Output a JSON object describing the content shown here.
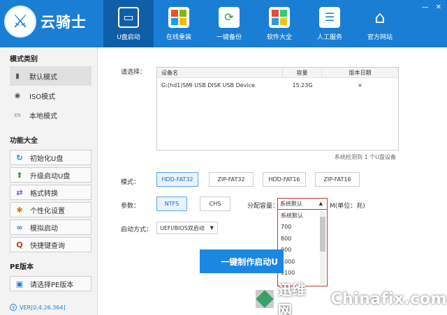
{
  "app": {
    "title": "云骑士",
    "logo_glyph": "⚔",
    "window_controls": [
      "—",
      "✕"
    ]
  },
  "nav": [
    {
      "label": "U盘启动",
      "active": true
    },
    {
      "label": "在线重装",
      "active": false
    },
    {
      "label": "一键备份",
      "active": false
    },
    {
      "label": "软件大全",
      "active": false
    },
    {
      "label": "人工服务",
      "active": false
    },
    {
      "label": "官方网站",
      "active": false
    }
  ],
  "sidebar": {
    "mode_title": "模式类别",
    "modes": [
      {
        "label": "默认模式",
        "icon": "usb-icon",
        "active": true
      },
      {
        "label": "ISO模式",
        "icon": "disc-icon",
        "active": false
      },
      {
        "label": "本地模式",
        "icon": "monitor-icon",
        "active": false
      }
    ],
    "func_title": "功能大全",
    "functions": [
      {
        "label": "初始化U盘",
        "icon": "refresh-icon",
        "color": "#1a7fd4",
        "glyph": "↻"
      },
      {
        "label": "升级启动U盘",
        "icon": "arrow-up-icon",
        "color": "#2a9a3a",
        "glyph": "⬆"
      },
      {
        "label": "格式转换",
        "icon": "convert-icon",
        "color": "#6a5acd",
        "glyph": "⇄"
      },
      {
        "label": "个性化设置",
        "icon": "gear-icon",
        "color": "#e07a10",
        "glyph": "✱"
      },
      {
        "label": "模拟启动",
        "icon": "link-icon",
        "color": "#1a7fd4",
        "glyph": "∞"
      },
      {
        "label": "快捷键查询",
        "icon": "search-icon",
        "color": "#c0392b",
        "glyph": "Q"
      }
    ],
    "pe_title": "PE版本",
    "pe_button": {
      "label": "请选择PE版本",
      "icon": "pe-icon"
    },
    "version": "VER[0.4.26.364]"
  },
  "main": {
    "select_label": "请选择：",
    "table": {
      "headers": [
        "设备名",
        "容量",
        "版本日期"
      ],
      "rows": [
        [
          "G:(hd1)SMI USB DISK USB Device",
          "15.23G",
          "×"
        ]
      ]
    },
    "detect_text": "系统检测到 1 个U盘设备",
    "mode_label": "模式：",
    "modes": [
      {
        "label": "HDD-FAT32",
        "selected": true
      },
      {
        "label": "ZIP-FAT32",
        "selected": false
      },
      {
        "label": "HDD-FAT16",
        "selected": false
      },
      {
        "label": "ZIP-FAT16",
        "selected": false
      }
    ],
    "param_label": "参数：",
    "params": [
      {
        "label": "NTFS",
        "selected": true
      },
      {
        "label": "CHS",
        "selected": false
      }
    ],
    "cluster_label": "分配容量：",
    "cluster_value": "系统默认",
    "cluster_unit": "M(单位：兆)",
    "cluster_options": [
      "系统默认",
      "700",
      "800",
      "900",
      "1000",
      "1100"
    ],
    "boot_label": "启动方式：",
    "boot_value": "UEFI/BIOS双启动",
    "make_button": "一键制作启动U"
  },
  "watermark": {
    "text1": "迅维网",
    "text2": "Chinafix.com"
  }
}
